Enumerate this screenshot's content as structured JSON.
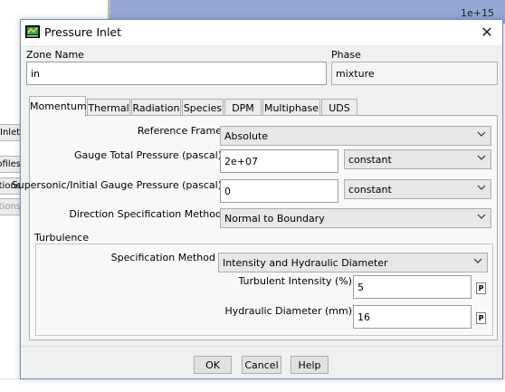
{
  "background": {
    "corner_label": "1e+15",
    "side_buttons": [
      {
        "label": "Inlet",
        "enabled": true
      },
      {
        "label": "Profiles",
        "enabled": true
      },
      {
        "label": "Conditions",
        "enabled": true
      },
      {
        "label": "Conditions",
        "enabled": false
      }
    ]
  },
  "dialog": {
    "title": "Pressure Inlet",
    "close_glyph": "✕",
    "zone_name_label": "Zone Name",
    "zone_name_value": "in",
    "phase_label": "Phase",
    "phase_value": "mixture"
  },
  "tabs": [
    "Momentum",
    "Thermal",
    "Radiation",
    "Species",
    "DPM",
    "Multiphase",
    "UDS"
  ],
  "active_tab": "Momentum",
  "momentum": {
    "reference_frame_label": "Reference Frame",
    "reference_frame_value": "Absolute",
    "gauge_total_pressure_label": "Gauge Total Pressure (pascal)",
    "gauge_total_pressure_value": "2e+07",
    "gauge_total_pressure_method": "constant",
    "supersonic_label": "Supersonic/Initial Gauge Pressure (pascal)",
    "supersonic_value": "0",
    "supersonic_method": "constant",
    "direction_label": "Direction Specification Method",
    "direction_value": "Normal to Boundary"
  },
  "turbulence": {
    "group_label": "Turbulence",
    "spec_method_label": "Specification Method",
    "spec_method_value": "Intensity and Hydraulic Diameter",
    "intensity_label": "Turbulent Intensity (%)",
    "intensity_value": "5",
    "diameter_label": "Hydraulic Diameter (mm)",
    "diameter_value": "16",
    "param_button_label": "P"
  },
  "buttons": {
    "ok": "OK",
    "cancel": "Cancel",
    "help": "Help"
  },
  "icons": {
    "app": "fluent-app-icon",
    "close": "close-icon",
    "dropdown": "chevron-down-icon"
  },
  "colors": {
    "dialog_border": "#6f90c8",
    "background_blue": "#96a7d6"
  }
}
